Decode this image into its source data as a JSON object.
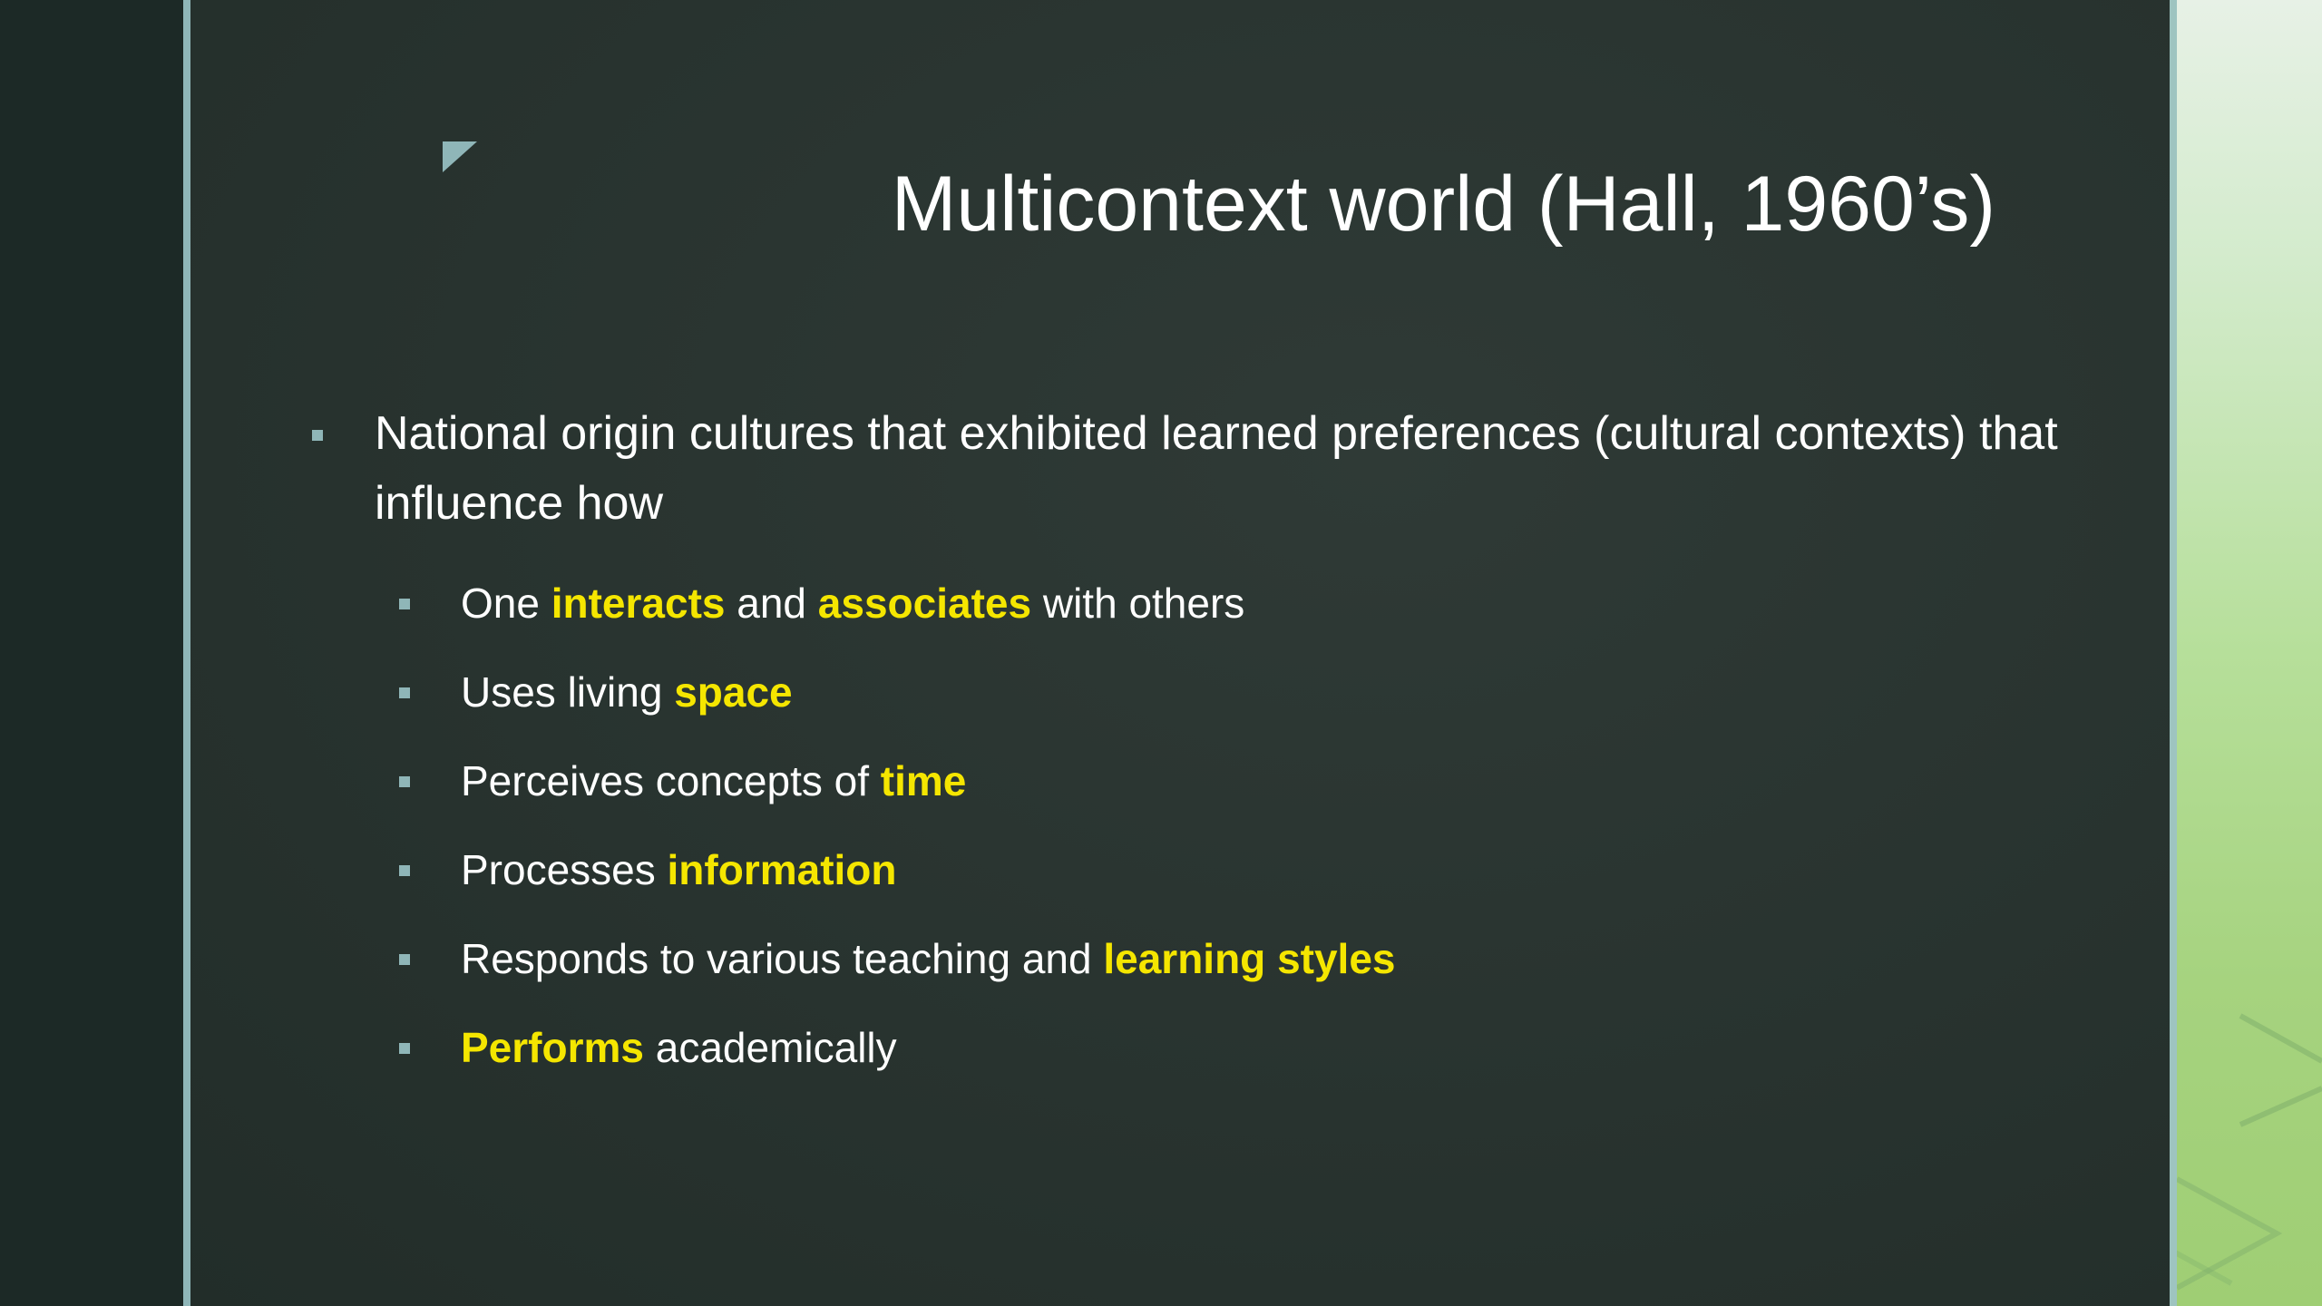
{
  "slide": {
    "title": "Multicontext world (Hall, 1960’s)",
    "main_bullet": "National origin cultures that exhibited learned preferences (cultural contexts) that influence how",
    "sub_bullets": [
      {
        "parts": [
          "One ",
          "interacts",
          " and ",
          "associates",
          " with others"
        ]
      },
      {
        "parts": [
          "Uses living ",
          "space"
        ]
      },
      {
        "parts": [
          "Perceives concepts of ",
          "time"
        ]
      },
      {
        "parts": [
          "Processes ",
          "information"
        ]
      },
      {
        "parts": [
          "Responds to various teaching and ",
          "learning styles"
        ]
      },
      {
        "parts": [
          "",
          "Performs",
          " academically"
        ]
      }
    ]
  },
  "colors": {
    "highlight": "#f5e600",
    "text": "#ffffff",
    "accent": "#8fb6b8",
    "background": "#28332f"
  },
  "icons": {
    "corner": "corner-triangle-icon",
    "bullet": "square-bullet-icon",
    "deco": "chevron-outline-icon"
  }
}
